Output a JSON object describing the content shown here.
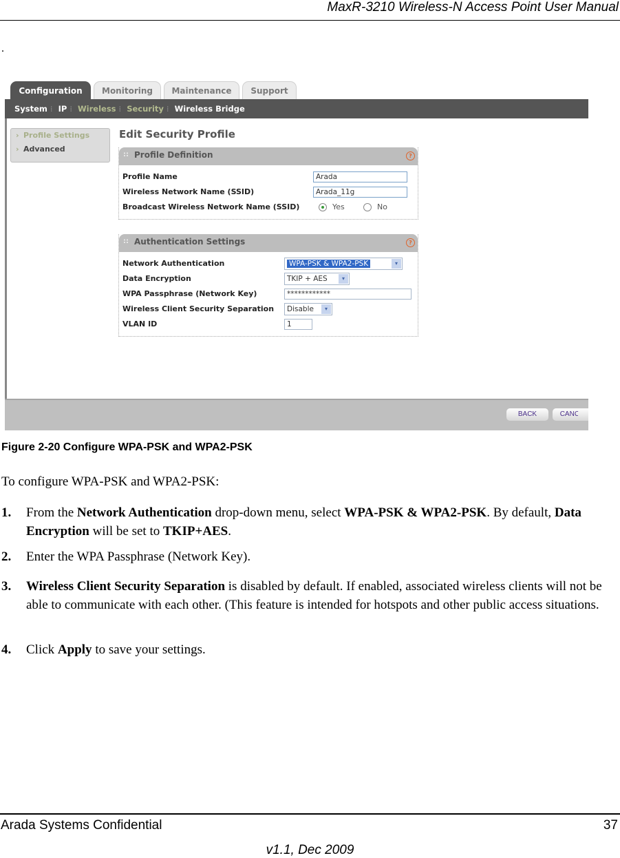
{
  "header": {
    "title": "MaxR-3210 Wireless-N Access Point User Manual",
    "dot": "."
  },
  "screenshot": {
    "tabs": [
      {
        "label": "Configuration",
        "active": true
      },
      {
        "label": "Monitoring",
        "active": false
      },
      {
        "label": "Maintenance",
        "active": false
      },
      {
        "label": "Support",
        "active": false
      }
    ],
    "subnav": [
      {
        "label": "System",
        "style": "normal"
      },
      {
        "label": "IP",
        "style": "normal"
      },
      {
        "label": "Wireless",
        "style": "selected"
      },
      {
        "label": "Security",
        "style": "selected"
      },
      {
        "label": "Wireless Bridge",
        "style": "normal"
      }
    ],
    "sidemenu": [
      {
        "label": "Profile Settings",
        "selected": true
      },
      {
        "label": "Advanced",
        "selected": false
      }
    ],
    "page_title": "Edit Security Profile",
    "profile_definition": {
      "title": "Profile Definition",
      "profile_name_label": "Profile Name",
      "profile_name_value": "Arada",
      "ssid_label": "Wireless Network Name (SSID)",
      "ssid_value": "Arada_11g",
      "broadcast_label": "Broadcast Wireless Network Name (SSID)",
      "broadcast_yes": "Yes",
      "broadcast_no": "No",
      "broadcast_selected": "Yes"
    },
    "auth_settings": {
      "title": "Authentication Settings",
      "net_auth_label": "Network Authentication",
      "net_auth_value": "WPA-PSK & WPA2-PSK",
      "encryption_label": "Data Encryption",
      "encryption_value": "TKIP + AES",
      "passphrase_label": "WPA Passphrase (Network Key)",
      "passphrase_value": "************",
      "separation_label": "Wireless Client Security Separation",
      "separation_value": "Disable",
      "vlan_label": "VLAN ID",
      "vlan_value": "1"
    },
    "buttons": {
      "back": "BACK",
      "cancel": "CANCEL"
    },
    "help_glyph": "?",
    "dropdown_glyph": "▾",
    "chevron_glyph": "›",
    "grip_glyph": "::"
  },
  "caption": "Figure 2-20  Configure WPA-PSK and WPA2-PSK",
  "intro": "To configure WPA-PSK and WPA2-PSK:",
  "steps": [
    {
      "num": "1.",
      "parts": [
        {
          "t": "From the ",
          "b": false
        },
        {
          "t": "Network Authentication",
          "b": true
        },
        {
          "t": " drop-down menu, select ",
          "b": false
        },
        {
          "t": "WPA-PSK & WPA2-PSK",
          "b": true
        },
        {
          "t": ". By default, ",
          "b": false
        },
        {
          "t": "Data Encryption",
          "b": true
        },
        {
          "t": " will be set to ",
          "b": false
        },
        {
          "t": "TKIP+AES",
          "b": true
        },
        {
          "t": ".",
          "b": false
        }
      ]
    },
    {
      "num": "2.",
      "parts": [
        {
          "t": "Enter the WPA Passphrase (Network Key).",
          "b": false
        }
      ]
    },
    {
      "num": "3.",
      "parts": [
        {
          "t": "Wireless Client Security Separation",
          "b": true
        },
        {
          "t": " is disabled by default. If enabled, associated wireless clients will not be able to communicate with each other. (This feature is intended for hotspots and other public access situations.",
          "b": false
        }
      ]
    },
    {
      "num": "4.",
      "parts": [
        {
          "t": "Click ",
          "b": false
        },
        {
          "t": "Apply",
          "b": true
        },
        {
          "t": " to save your settings.",
          "b": false
        }
      ]
    }
  ],
  "footer": {
    "left": "Arada Systems Confidential",
    "page": "37",
    "version": "v1.1, Dec 2009"
  }
}
